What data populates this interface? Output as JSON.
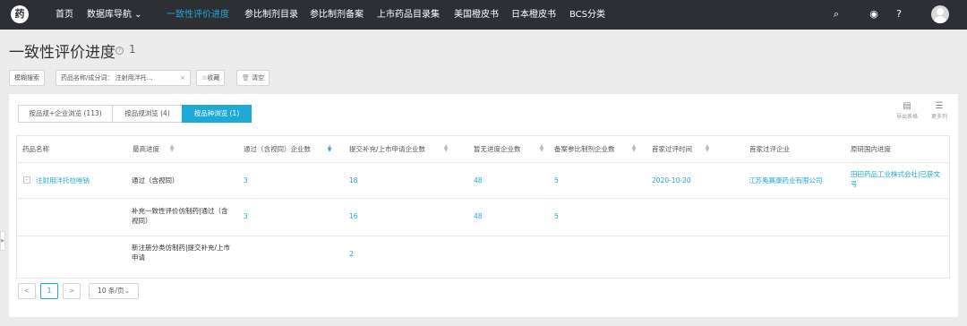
{
  "nav": {
    "logo": "药",
    "items": [
      {
        "label": "首页"
      },
      {
        "label": "数据库导航 ⌄"
      },
      {
        "label": "一致性评价进度"
      },
      {
        "label": "参比制剂目录"
      },
      {
        "label": "参比制剂备案"
      },
      {
        "label": "上市药品目录集"
      },
      {
        "label": "美国橙皮书"
      },
      {
        "label": "日本橙皮书"
      },
      {
        "label": "BCS分类"
      }
    ],
    "icons": [
      "search-icon",
      "bulb-icon",
      "help-icon"
    ]
  },
  "page": {
    "title": "一致性评价进度",
    "count": "1"
  },
  "filters": {
    "fuzzy": "模糊搜索",
    "chip": "药品名称/成分词：  注射用泮托…",
    "chip_close": "×",
    "favorite": "☆收藏",
    "clear": "清空"
  },
  "view_tabs": [
    {
      "label": "按品规+企业浏览 (113)"
    },
    {
      "label": "按品规浏览 (4)"
    },
    {
      "label": "按品种浏览 (1)",
      "active": true
    }
  ],
  "tools": {
    "export": "导出表格",
    "more": "更多列"
  },
  "table": {
    "headers": [
      "药品名称",
      "最高进度",
      "通过（含视同）企业数",
      "提交补充/上市申请企业数",
      "暂无进度企业数",
      "备案参比制剂企业数",
      "首家过评时间",
      "首家过评企业",
      "原研国内进度"
    ],
    "rows": [
      {
        "drug": "注射用泮托拉唑钠",
        "progress": "通过（含视同）",
        "passed": "3",
        "submitted": "18",
        "none": "48",
        "filed": "5",
        "first_date": "2020-10-20",
        "first_company": "江苏奥赛康药业有限公司",
        "original": "田田药品工业株式会社|已获文号"
      },
      {
        "drug": "",
        "progress": "补充一致性评价仿制药|通过（含视同）",
        "passed": "3",
        "submitted": "16",
        "none": "48",
        "filed": "5",
        "first_date": "",
        "first_company": "",
        "original": ""
      },
      {
        "drug": "",
        "progress": "新注册分类仿制药|提交补充/上市申请",
        "passed": "",
        "submitted": "2",
        "none": "",
        "filed": "",
        "first_date": "",
        "first_company": "",
        "original": ""
      }
    ]
  },
  "pagination": {
    "prev": "<",
    "current": "1",
    "next": ">",
    "page_size": "10 条/页⌄"
  },
  "colors": {
    "nav_bg": "#2d2f35",
    "accent": "#1ea9d6"
  }
}
